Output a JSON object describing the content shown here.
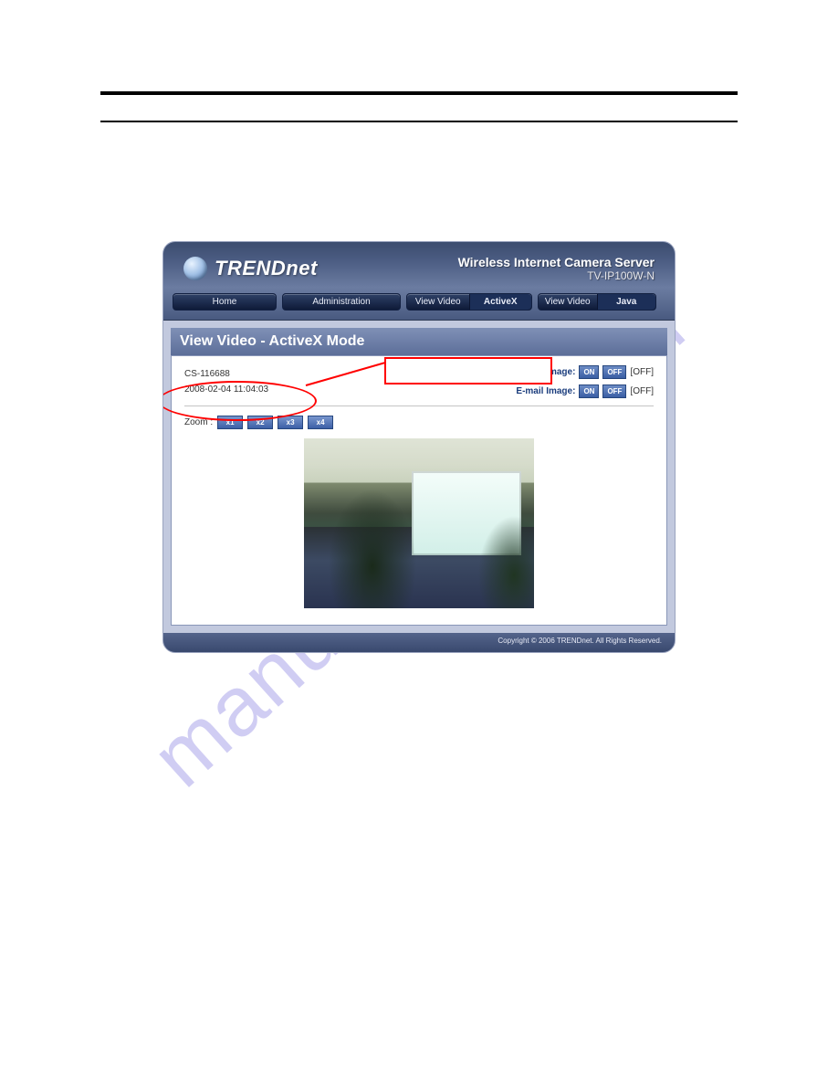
{
  "header": {
    "brand": "TRENDnet",
    "title": "Wireless Internet Camera Server",
    "model": "TV-IP100W-N"
  },
  "nav": {
    "home": "Home",
    "admin": "Administration",
    "view_activex_left": "View Video",
    "view_activex_right": "ActiveX",
    "view_java_left": "View Video",
    "view_java_right": "Java"
  },
  "panel": {
    "title": "View Video - ActiveX Mode",
    "camera_id": "CS-116688",
    "timestamp": "2008-02-04 11:04:03",
    "upload_label": "Upload Image:",
    "email_label": "E-mail Image:",
    "btn_on": "ON",
    "btn_off": "OFF",
    "state_off": "[OFF]",
    "zoom_label": "Zoom :",
    "zoom": {
      "x1": "x1",
      "x2": "x2",
      "x3": "x3",
      "x4": "x4"
    }
  },
  "footer": "Copyright © 2006 TRENDnet. All Rights Reserved.",
  "watermark": "manualshive.com"
}
